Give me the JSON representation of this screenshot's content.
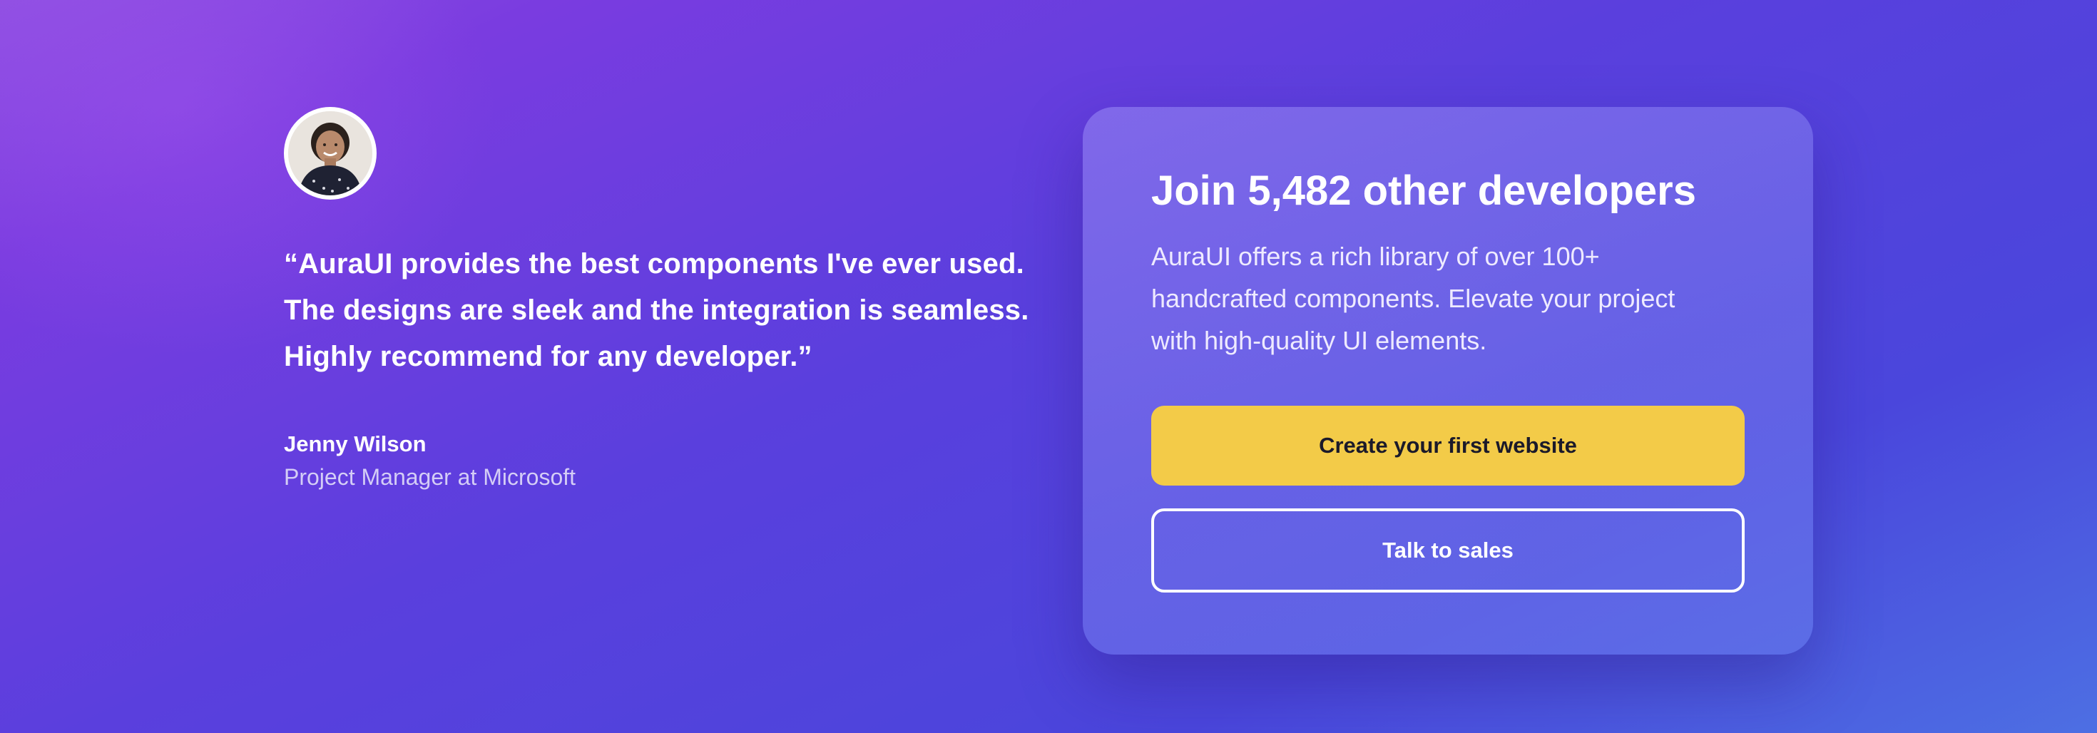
{
  "testimonial": {
    "avatar_icon": "person-portrait",
    "quote_lines": [
      "“AuraUI provides the best components I've ever used.",
      "The designs are sleek and the integration is seamless.",
      "Highly recommend for any developer.”"
    ],
    "author_name": "Jenny Wilson",
    "author_role": "Project Manager at Microsoft"
  },
  "cta": {
    "title": "Join 5,482 other developers",
    "description_lines": [
      "AuraUI offers a rich library of over 100+",
      "handcrafted components. Elevate your project",
      "with high-quality UI elements."
    ],
    "primary_button": "Create your first website",
    "secondary_button": "Talk to sales"
  },
  "colors": {
    "background_start": "#8f4fe2",
    "background_end": "#4d6fe3",
    "primary_button": "#f3cb48",
    "text": "#ffffff"
  }
}
